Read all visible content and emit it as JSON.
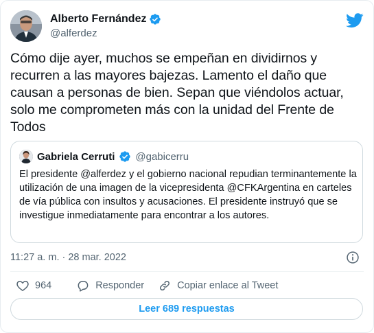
{
  "colors": {
    "accent": "#1d9bf0",
    "text": "#0f1419",
    "muted": "#536471",
    "border": "#cfd9de"
  },
  "tweet": {
    "author_name": "Alberto Fernández",
    "author_handle": "@alferdez",
    "text": "Cómo dije ayer, muchos se empeñan en dividirnos y recurren a las mayores bajezas. Lamento el daño que causan a personas de bien. Sepan que viéndolos actuar, solo me comprometen más con la unidad del Frente de Todos",
    "timestamp": "11:27 a. m. · 28 mar. 2022"
  },
  "quote": {
    "author_name": "Gabriela Cerruti",
    "author_handle": "@gabicerru",
    "text": "El presidente @alferdez y el gobierno nacional repudian terminantemente la utilización de una imagen de la vicepresidenta @CFKArgentina en carteles de vía pública con insultos y acusaciones. El presidente instruyó que se investigue inmediatamente para encontrar a los autores."
  },
  "actions": {
    "like_count": "964",
    "reply_label": "Responder",
    "copy_label": "Copiar enlace al Tweet"
  },
  "replies_button": "Leer 689 respuestas",
  "icons": {
    "logo": "twitter-bird-icon",
    "verified": "verified-badge-icon",
    "info": "info-icon",
    "like": "heart-icon",
    "reply": "reply-bubble-icon",
    "copy": "link-icon"
  }
}
